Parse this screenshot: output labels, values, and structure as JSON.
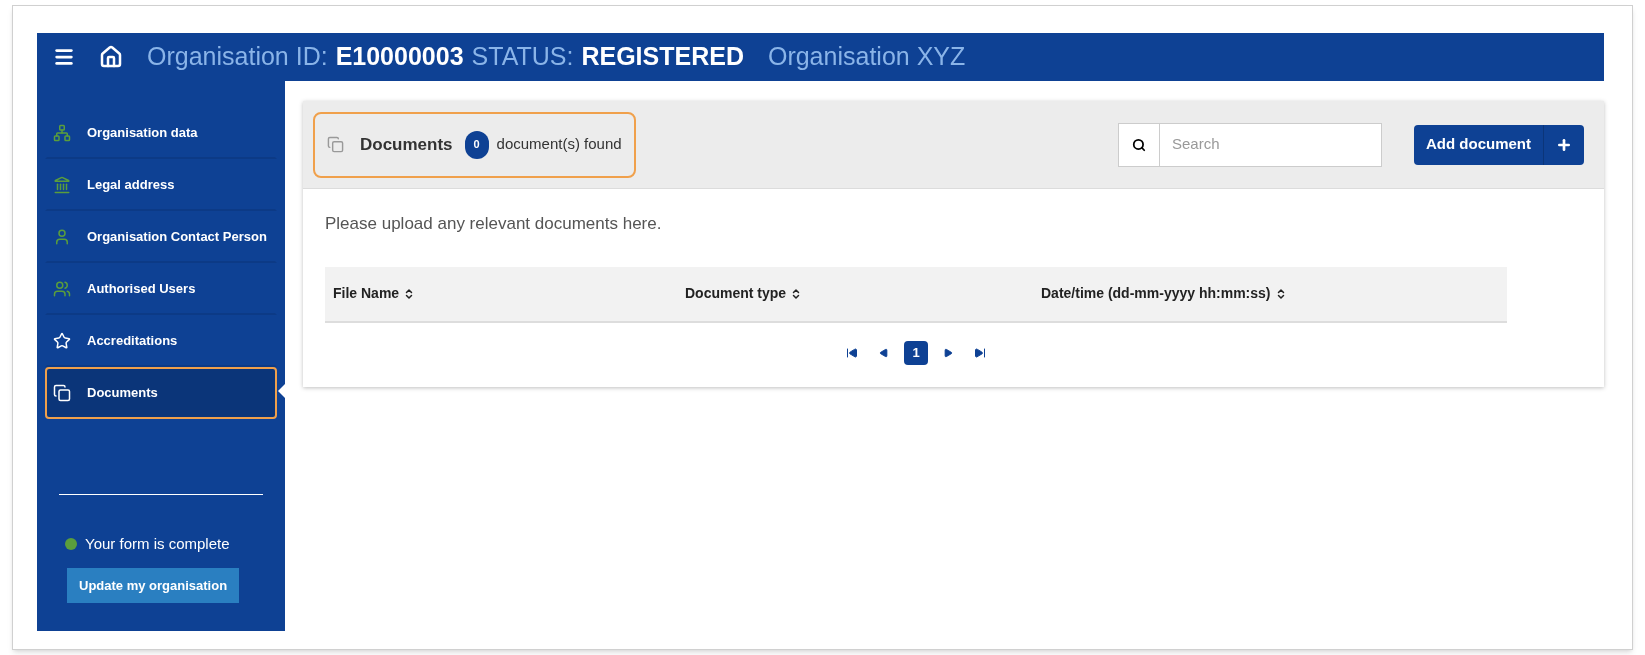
{
  "header": {
    "id_label": "Organisation ID:",
    "id_value": "E10000003",
    "status_label": "STATUS:",
    "status_value": "REGISTERED",
    "organisation_name": "Organisation XYZ"
  },
  "sidebar": {
    "items": [
      {
        "label": "Organisation data",
        "kind": "sitemap",
        "selected": false,
        "highlighted": false
      },
      {
        "label": "Legal address",
        "kind": "bank",
        "selected": false,
        "highlighted": false
      },
      {
        "label": "Organisation Contact Person",
        "kind": "person",
        "selected": false,
        "highlighted": false
      },
      {
        "label": "Authorised Users",
        "kind": "people",
        "selected": false,
        "highlighted": false
      },
      {
        "label": "Accreditations",
        "kind": "star",
        "selected": false,
        "highlighted": false
      },
      {
        "label": "Documents",
        "kind": "copy",
        "selected": true,
        "highlighted": true
      }
    ],
    "form_status": {
      "text": "Your form is complete",
      "color": "#5a9e3c"
    },
    "update_button": "Update my organisation"
  },
  "panel": {
    "title": "Documents",
    "count": "0",
    "count_suffix": "document(s) found",
    "highlighted": true,
    "search": {
      "placeholder": "Search"
    },
    "add_button": "Add document",
    "intro": "Please upload any relevant documents here.",
    "table": {
      "columns": [
        "File Name",
        "Document type",
        "Date/time (dd-mm-yyyy hh:mm:ss)"
      ]
    },
    "pagination": [
      {
        "kind": "first",
        "selected": false
      },
      {
        "kind": "prev",
        "selected": false
      },
      {
        "kind": "page",
        "label": "1",
        "selected": true
      },
      {
        "kind": "next",
        "selected": false
      },
      {
        "kind": "last",
        "selected": false
      }
    ]
  }
}
